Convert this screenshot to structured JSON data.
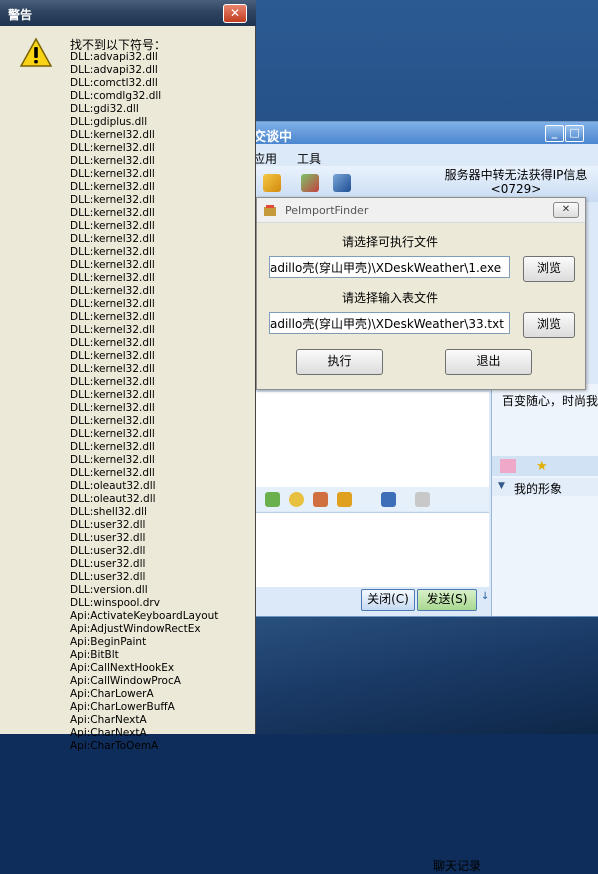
{
  "warning_window": {
    "title": "警告",
    "close_label": "✕",
    "heading": "找不到以下符号：",
    "symbols": [
      "DLL:advapi32.dll",
      "DLL:advapi32.dll",
      "DLL:comctl32.dll",
      "DLL:comdlg32.dll",
      "DLL:gdi32.dll",
      "DLL:gdiplus.dll",
      "DLL:kernel32.dll",
      "DLL:kernel32.dll",
      "DLL:kernel32.dll",
      "DLL:kernel32.dll",
      "DLL:kernel32.dll",
      "DLL:kernel32.dll",
      "DLL:kernel32.dll",
      "DLL:kernel32.dll",
      "DLL:kernel32.dll",
      "DLL:kernel32.dll",
      "DLL:kernel32.dll",
      "DLL:kernel32.dll",
      "DLL:kernel32.dll",
      "DLL:kernel32.dll",
      "DLL:kernel32.dll",
      "DLL:kernel32.dll",
      "DLL:kernel32.dll",
      "DLL:kernel32.dll",
      "DLL:kernel32.dll",
      "DLL:kernel32.dll",
      "DLL:kernel32.dll",
      "DLL:kernel32.dll",
      "DLL:kernel32.dll",
      "DLL:kernel32.dll",
      "DLL:kernel32.dll",
      "DLL:kernel32.dll",
      "DLL:kernel32.dll",
      "DLL:oleaut32.dll",
      "DLL:oleaut32.dll",
      "DLL:shell32.dll",
      "DLL:user32.dll",
      "DLL:user32.dll",
      "DLL:user32.dll",
      "DLL:user32.dll",
      "DLL:user32.dll",
      "DLL:version.dll",
      "DLL:winspool.drv",
      "Api:ActivateKeyboardLayout",
      "Api:AdjustWindowRectEx",
      "Api:BeginPaint",
      "Api:BitBlt",
      "Api:CallNextHookEx",
      "Api:CallWindowProcA",
      "Api:CharLowerA",
      "Api:CharLowerBuffA",
      "Api:CharNextA",
      "Api:CharNextA",
      "Api:CharToOemA"
    ]
  },
  "chat_window": {
    "title_fragment": "交谈中",
    "menu": [
      "应用",
      "工具"
    ],
    "server_message": "服务器中转无法获得IP信息",
    "server_code": "<0729>",
    "ad_text": "百变随心，时尚我",
    "my_image_label": "我的形象",
    "history_label": "聊天记录",
    "close_button": "关闭(C)",
    "send_button": "发送(S)"
  },
  "pe_dialog": {
    "title": "PeImportFinder",
    "close_label": "✕",
    "exe_label": "请选择可执行文件",
    "exe_path": "adillo壳(穿山甲壳)\\XDeskWeather\\1.exe",
    "table_label": "请选择输入表文件",
    "table_path": "adillo壳(穿山甲壳)\\XDeskWeather\\33.txt",
    "browse": "浏览",
    "run": "执行",
    "exit": "退出"
  }
}
